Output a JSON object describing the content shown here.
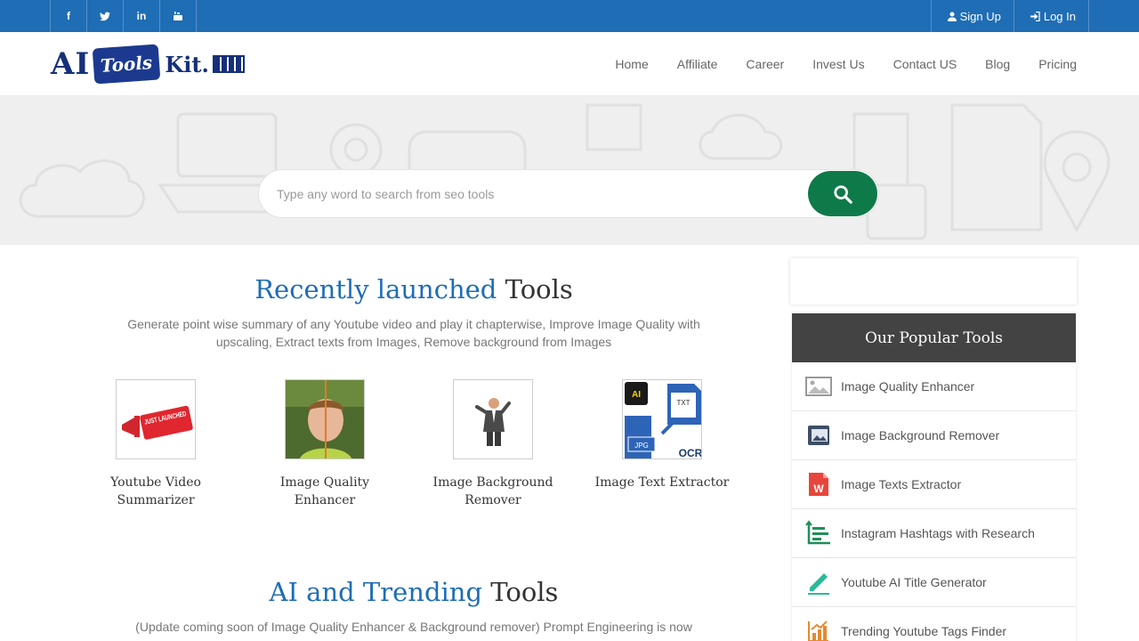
{
  "topbar": {
    "social": [
      {
        "icon": "facebook-icon",
        "glyph": "f"
      },
      {
        "icon": "twitter-icon",
        "glyph": "t"
      },
      {
        "icon": "linkedin-icon",
        "glyph": "in"
      },
      {
        "icon": "youtube-icon",
        "glyph": "▶"
      }
    ],
    "signup_label": "Sign Up",
    "login_label": "Log In"
  },
  "header": {
    "logo": {
      "ai": "AI",
      "tools": "Tools",
      "kit": "Kit."
    },
    "nav": [
      "Home",
      "Affiliate",
      "Career",
      "Invest Us",
      "Contact US",
      "Blog",
      "Pricing"
    ]
  },
  "search": {
    "placeholder": "Type any word to search from seo tools"
  },
  "recent": {
    "title_accent": "Recently launched",
    "title_rest": "Tools",
    "description": "Generate point wise summary of any Youtube video and play it chapterwise, Improve Image Quality with upscaling, Extract texts from Images, Remove background from Images",
    "tools": [
      {
        "name": "Youtube Video Summarizer",
        "badge": "JUST LAUNCHED"
      },
      {
        "name": "Image Quality Enhancer"
      },
      {
        "name": "Image Background Remover"
      },
      {
        "name": "Image Text Extractor",
        "labels": [
          "AI",
          "TXT",
          "JPG",
          "OCR"
        ]
      }
    ]
  },
  "trending": {
    "title_accent": "AI and Trending",
    "title_rest": "Tools",
    "description": "(Update coming soon of Image Quality Enhancer & Background remover) Prompt Engineering is now"
  },
  "sidebar": {
    "popular_title": "Our Popular Tools",
    "items": [
      {
        "label": "Image Quality Enhancer",
        "icon": "image-icon"
      },
      {
        "label": "Image Background Remover",
        "icon": "image-stack-icon"
      },
      {
        "label": "Image Texts Extractor",
        "icon": "word-doc-icon"
      },
      {
        "label": "Instagram Hashtags with Research",
        "icon": "bar-chart-icon"
      },
      {
        "label": "Youtube AI Title Generator",
        "icon": "pencil-icon"
      },
      {
        "label": "Trending Youtube Tags Finder",
        "icon": "growth-chart-icon"
      }
    ]
  },
  "colors": {
    "brand_blue": "#1f6db5",
    "search_button": "#0e7a49",
    "sidebar_header": "#434343"
  }
}
